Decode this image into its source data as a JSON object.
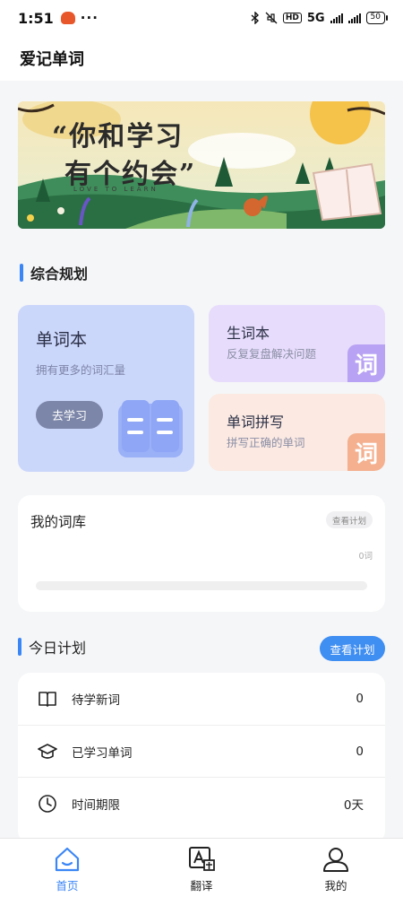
{
  "status_bar": {
    "time": "1:51",
    "more": "···",
    "hd": "HD",
    "network": "5G",
    "battery": "50"
  },
  "header": {
    "title": "爱记单词"
  },
  "banner": {
    "headline_line1": "“你和学习",
    "headline_line2": "有个约会”",
    "subtitle": "LOVE TO LEARN"
  },
  "section_overall": {
    "title": "综合规划"
  },
  "cards": {
    "wordbook": {
      "title": "单词本",
      "subtitle": "拥有更多的词汇量",
      "button": "去学习"
    },
    "new_words": {
      "title": "生词本",
      "subtitle": "反复复盘解决问题",
      "icon_char": "词"
    },
    "spelling": {
      "title": "单词拼写",
      "subtitle": "拼写正确的单词",
      "icon_char": "词"
    }
  },
  "library": {
    "title": "我的词库",
    "button": "查看计划",
    "count": "0词",
    "progress": 0
  },
  "today_plan": {
    "title": "今日计划",
    "button": "查看计划",
    "rows": [
      {
        "label": "待学新词",
        "value": "0",
        "icon": "book-icon"
      },
      {
        "label": "已学习单词",
        "value": "0",
        "icon": "graduation-cap-icon"
      },
      {
        "label": "时间期限",
        "value": "0天",
        "icon": "clock-icon"
      }
    ]
  },
  "bottom_nav": {
    "items": [
      {
        "label": "首页",
        "icon": "home-icon",
        "active": true
      },
      {
        "label": "翻译",
        "icon": "translate-icon",
        "active": false
      },
      {
        "label": "我的",
        "icon": "user-icon",
        "active": false
      }
    ]
  },
  "colors": {
    "accent": "#3b86f6",
    "wordbook_card": "#cbd6fb",
    "new_words_card": "#e7dcfc",
    "spelling_card": "#fbe9e2"
  }
}
